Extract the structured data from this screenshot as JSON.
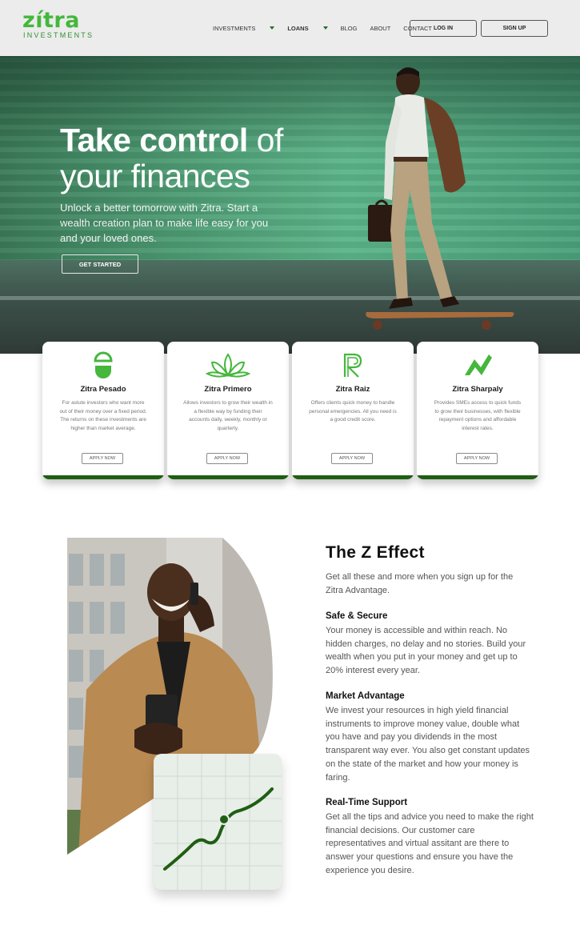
{
  "brand": {
    "logo_word": "zítra",
    "logo_sub": "INVESTMENTS",
    "accent": "#44b73c",
    "dark_green": "#1f5e14"
  },
  "nav": {
    "items": [
      {
        "label": "INVESTMENTS",
        "has_caret": true
      },
      {
        "label": "LOANS",
        "has_caret": true
      },
      {
        "label": "BLOG",
        "has_caret": false
      },
      {
        "label": "ABOUT",
        "has_caret": false
      },
      {
        "label": "CONTACT",
        "has_caret": false
      }
    ],
    "login": "LOG IN",
    "signup": "SIGN UP"
  },
  "hero": {
    "title_bold": "Take control",
    "title_light": "of",
    "title_line2": "your finances",
    "subtitle": "Unlock a better tomorrow with Zitra. Start a wealth creation plan to make life easy for you and your loved ones.",
    "cta": "GET STARTED"
  },
  "products": [
    {
      "icon": "circle-split-icon",
      "title": "Zitra Pesado",
      "description": "For astute investors who want more out of their money over a fixed period. The returns on these investments are higher than market average.",
      "button": "APPLY NOW"
    },
    {
      "icon": "lotus-icon",
      "title": "Zitra Primero",
      "description": "Allows investors to grow their wealth in a flexible way by funding their accounts daily, weekly, monthly or quarterly.",
      "button": "APPLY NOW"
    },
    {
      "icon": "letter-r-icon",
      "title": "Zitra Raiz",
      "description": "Offers clients quick money to handle personal emergencies. All you need is a good credit score.",
      "button": "APPLY NOW"
    },
    {
      "icon": "zigzag-n-icon",
      "title": "Zitra Sharpaly",
      "description": "Provides SMEs access to quick funds to grow their businesses, with flexible repayment options and affordable interest rates.",
      "button": "APPLY NOW"
    }
  ],
  "z_effect": {
    "title": "The Z Effect",
    "intro": "Get all these and more when you sign up for the Zitra Advantage.",
    "features": [
      {
        "heading": "Safe & Secure",
        "text": "Your money is accessible and within reach. No hidden charges, no delay and no stories. Build your wealth when you put in your money and get up to 20% interest every year."
      },
      {
        "heading": "Market Advantage",
        "text": "We invest your resources in high yield financial instruments to improve money value, double what you have and pay you dividends in the most transparent way ever. You also get constant updates on the state of the market and how your money is faring."
      },
      {
        "heading": "Real-Time Support",
        "text": "Get all the tips and advice you need to make the right financial decisions. Our customer care representatives and virtual assitant are there to answer your questions and ensure you have the experience you desire."
      }
    ]
  }
}
